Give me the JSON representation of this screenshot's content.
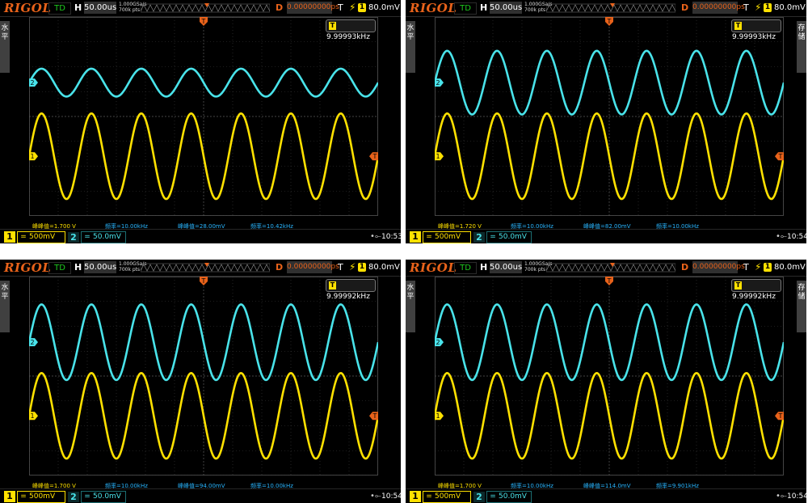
{
  "panels": [
    {
      "id": "tl",
      "header": {
        "logo": "RIGOL",
        "td": "TD",
        "h_label": "H",
        "timebase": "50.00us",
        "sample_rate": "1.000GSa/s",
        "memory": "700k pts",
        "d_label": "D",
        "delay": "0.00000000ps",
        "t_label": "T",
        "trig_ch": "1",
        "trig_level": "80.0mV"
      },
      "side_tabs": [
        "水平"
      ],
      "freq_readout": "9.99993kHz",
      "measurements": {
        "ch1_vpp": "峰峰值=1.700 V",
        "ch1_freq": "频率=10.00kHz",
        "ch2_vpp": "峰峰值=28.00mV",
        "ch2_freq": "频率=10.42kHz"
      },
      "footer": {
        "ch1": "1",
        "ch1_scale": "500mV",
        "ch2": "2",
        "ch2_scale": "50.0mV",
        "time": "10:53"
      },
      "ch2_amplitude": 0.07
    },
    {
      "id": "tr",
      "header": {
        "logo": "RIGOL",
        "td": "TD",
        "h_label": "H",
        "timebase": "50.00us",
        "sample_rate": "1.000GSa/s",
        "memory": "700k pts",
        "d_label": "D",
        "delay": "0.00000000ps",
        "t_label": "T",
        "trig_ch": "1",
        "trig_level": "80.0mV"
      },
      "side_tabs": [
        "存储",
        "水平"
      ],
      "freq_readout": "9.99993kHz",
      "measurements": {
        "ch1_vpp": "峰峰值=1.720 V",
        "ch1_freq": "频率=10.00kHz",
        "ch2_vpp": "峰峰值=82.00mV",
        "ch2_freq": "频率=10.00kHz"
      },
      "footer": {
        "ch1": "1",
        "ch1_scale": "500mV",
        "ch2": "2",
        "ch2_scale": "50.0mV",
        "time": "10:54"
      },
      "ch2_amplitude": 0.16
    },
    {
      "id": "bl",
      "header": {
        "logo": "RIGOL",
        "td": "TD",
        "h_label": "H",
        "timebase": "50.00us",
        "sample_rate": "1.000GSa/s",
        "memory": "700k pts",
        "d_label": "D",
        "delay": "0.00000000ps",
        "t_label": "T",
        "trig_ch": "1",
        "trig_level": "80.0mV"
      },
      "side_tabs": [
        "水平"
      ],
      "freq_readout": "9.99992kHz",
      "measurements": {
        "ch1_vpp": "峰峰值=1.700 V",
        "ch1_freq": "频率=10.00kHz",
        "ch2_vpp": "峰峰值=94.00mV",
        "ch2_freq": "频率=10.00kHz"
      },
      "footer": {
        "ch1": "1",
        "ch1_scale": "500mV",
        "ch2": "2",
        "ch2_scale": "50.0mV",
        "time": "10:54"
      },
      "ch2_amplitude": 0.19
    },
    {
      "id": "br",
      "header": {
        "logo": "RIGOL",
        "td": "TD",
        "h_label": "H",
        "timebase": "50.00us",
        "sample_rate": "1.000GSa/s",
        "memory": "700k pts",
        "d_label": "D",
        "delay": "0.00000000ps",
        "t_label": "T",
        "trig_ch": "1",
        "trig_level": "80.0mV"
      },
      "side_tabs": [
        "存储",
        "水平"
      ],
      "freq_readout": "9.99992kHz",
      "measurements": {
        "ch1_vpp": "峰峰值=1.700 V",
        "ch1_freq": "频率=10.00kHz",
        "ch2_vpp": "峰峰值=114.0mV",
        "ch2_freq": "频率=9.901kHz"
      },
      "footer": {
        "ch1": "1",
        "ch1_scale": "500mV",
        "ch2": "2",
        "ch2_scale": "50.0mV",
        "time": "10:54"
      },
      "ch2_amplitude": 0.19
    }
  ],
  "colors": {
    "ch1": "#ffe100",
    "ch2": "#49e3ea",
    "trigger": "#e8621a",
    "grid": "#3a3a3a",
    "background": "#000000"
  },
  "icons": {
    "usb": "usb-icon",
    "trigger_edge": "rising-edge-icon"
  }
}
